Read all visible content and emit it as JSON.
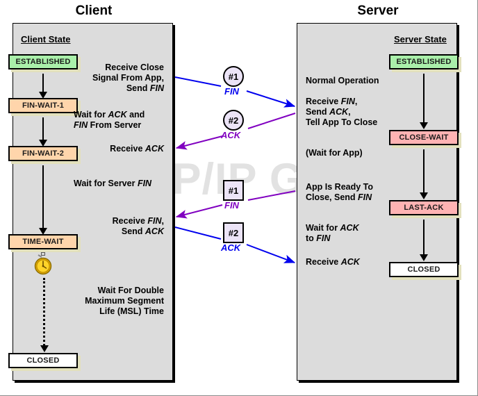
{
  "diagram": {
    "watermark": "The TCP/IP Guide",
    "client_heading": "Client",
    "server_heading": "Server"
  },
  "client": {
    "panel_title": "Client State",
    "states": [
      {
        "label": "ESTABLISHED",
        "color": "#aaf0aa"
      },
      {
        "label": "FIN-WAIT-1",
        "color": "#ffd5ab"
      },
      {
        "label": "FIN-WAIT-2",
        "color": "#ffd5ab"
      },
      {
        "label": "TIME-WAIT",
        "color": "#ffd5ab"
      },
      {
        "label": "CLOSED",
        "color": "#ffffff"
      }
    ],
    "notes": [
      "Receive Close\nSignal From App,\nSend FIN",
      "Wait for ACK and\nFIN From Server",
      "Receive ACK",
      "Wait for Server FIN",
      "Receive FIN,\nSend ACK",
      "Wait For Double\nMaximum Segment\nLife (MSL) Time"
    ]
  },
  "server": {
    "panel_title": "Server State",
    "states": [
      {
        "label": "ESTABLISHED",
        "color": "#aaf0aa"
      },
      {
        "label": "CLOSE-WAIT",
        "color": "#ffb3b3"
      },
      {
        "label": "LAST-ACK",
        "color": "#ffb3b3"
      },
      {
        "label": "CLOSED",
        "color": "#ffffff"
      }
    ],
    "notes": [
      "Normal Operation",
      "Receive FIN,\nSend ACK,\nTell App To Close",
      "(Wait for App)",
      "App Is Ready To\nClose, Send FIN",
      "Wait for ACK\nto FIN",
      "Receive ACK"
    ]
  },
  "messages": [
    {
      "marker": "#1",
      "label": "FIN",
      "shape": "circle",
      "direction": "client-to-server",
      "color": "#0000ee"
    },
    {
      "marker": "#2",
      "label": "ACK",
      "shape": "circle",
      "direction": "server-to-client",
      "color": "#8000c0"
    },
    {
      "marker": "#1",
      "label": "FIN",
      "shape": "square",
      "direction": "server-to-client",
      "color": "#8000c0"
    },
    {
      "marker": "#2",
      "label": "ACK",
      "shape": "square",
      "direction": "client-to-server",
      "color": "#0000ee"
    }
  ],
  "colors": {
    "established": "#aaf0aa",
    "wait": "#ffd5ab",
    "close": "#ffb3b3",
    "closed": "#ffffff",
    "panel_bg": "#dcdcdc",
    "blue_arrow": "#0000ee",
    "purple_arrow": "#8000c0",
    "marker_fill": "#ece4f7",
    "shadow": "#e2e0bc"
  }
}
